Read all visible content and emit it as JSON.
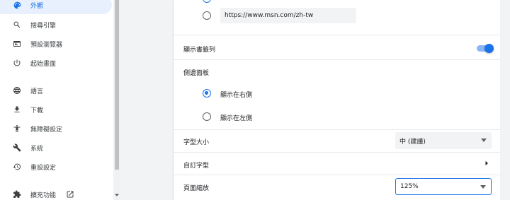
{
  "sidebar": {
    "items": [
      {
        "label": "外觀",
        "icon": "palette-icon",
        "active": true
      },
      {
        "label": "搜尋引擎",
        "icon": "search-icon"
      },
      {
        "label": "預設瀏覽器",
        "icon": "browser-icon"
      },
      {
        "label": "起始畫面",
        "icon": "power-icon"
      },
      {
        "label": "語言",
        "icon": "globe-icon"
      },
      {
        "label": "下載",
        "icon": "download-icon"
      },
      {
        "label": "無障礙設定",
        "icon": "accessibility-icon"
      },
      {
        "label": "系統",
        "icon": "wrench-icon"
      },
      {
        "label": "重設設定",
        "icon": "restore-icon"
      },
      {
        "label": "擴充功能",
        "icon": "puzzle-icon"
      }
    ]
  },
  "appearance": {
    "homepage_url": "https://www.msn.com/zh-tw",
    "bookmarks_bar_label": "顯示書籤列",
    "bookmarks_bar_on": true,
    "side_panel_label": "側邊面板",
    "side_panel_options": [
      "顯示在右側",
      "顯示在左側"
    ],
    "side_panel_selected": 0,
    "font_size_label": "字型大小",
    "font_size_value": "中 (建議)",
    "custom_fonts_label": "自訂字型",
    "page_zoom_label": "頁面縮放",
    "page_zoom_value": "125%"
  },
  "colors": {
    "accent": "#1a73e8",
    "active_bg": "#e8f0fe"
  }
}
